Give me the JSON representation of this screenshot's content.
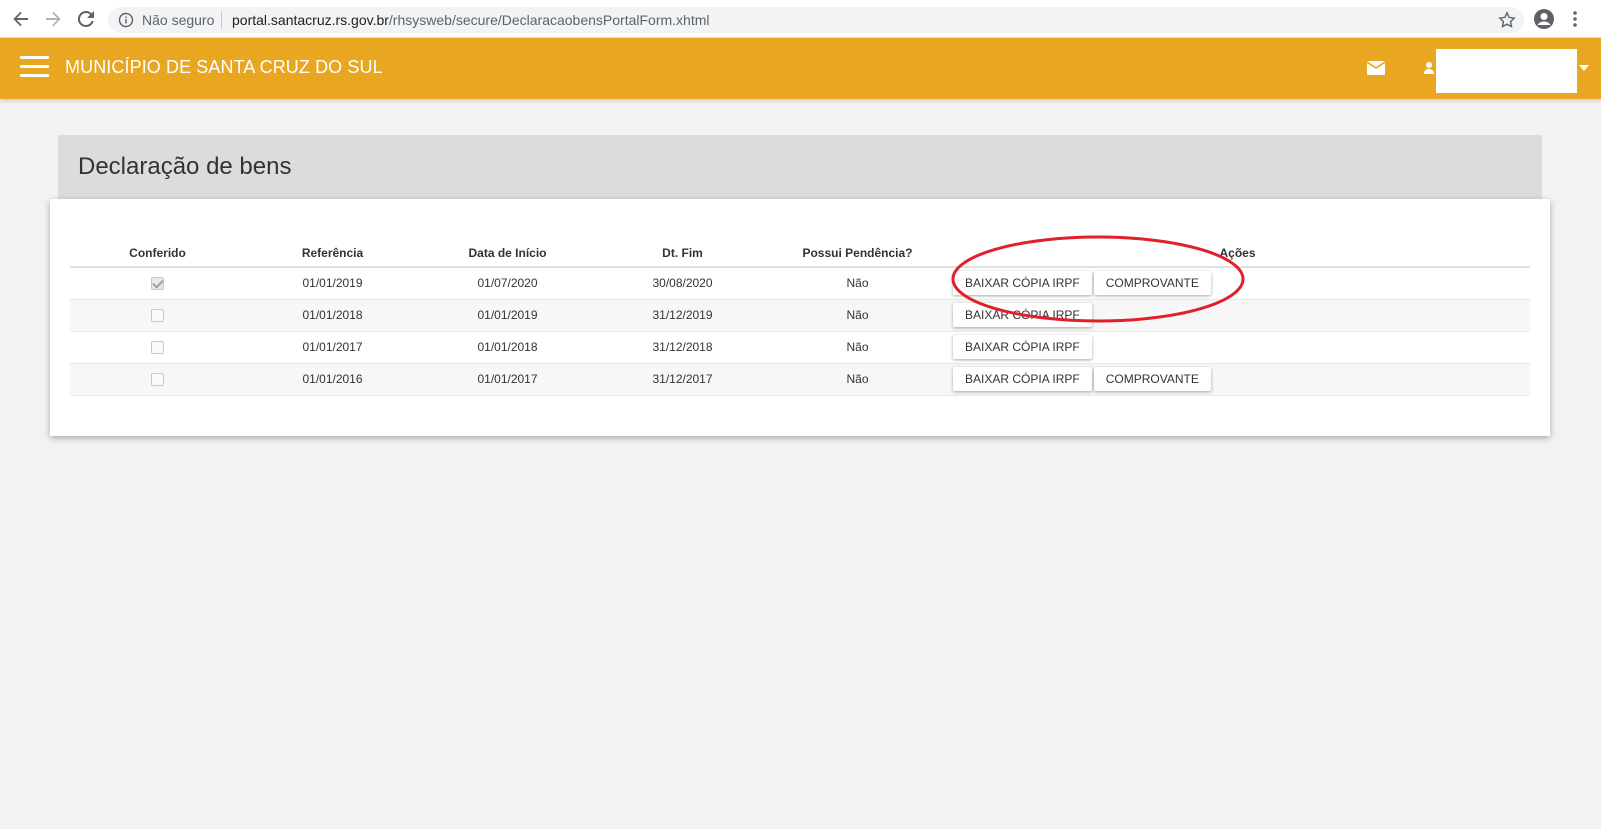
{
  "browser": {
    "not_secure": "Não seguro",
    "url_domain": "portal.santacruz.rs.gov.br",
    "url_path": "/rhsysweb/secure/DeclaracaobensPortalForm.xhtml"
  },
  "header": {
    "title": "MUNICÍPIO DE SANTA CRUZ DO SUL",
    "color": "#e9a620"
  },
  "panel": {
    "title": "Declaração de bens"
  },
  "table": {
    "columns": {
      "conferido": "Conferido",
      "referencia": "Referência",
      "data_inicio": "Data de Início",
      "dt_fim": "Dt. Fim",
      "pendencia": "Possui Pendência?",
      "acoes": "Ações"
    },
    "rows": [
      {
        "conferido": true,
        "referencia": "01/01/2019",
        "data_inicio": "01/07/2020",
        "dt_fim": "30/08/2020",
        "pendencia": "Não",
        "btn_irpf": "BAIXAR CÓPIA IRPF",
        "btn_comprovante": "COMPROVANTE"
      },
      {
        "conferido": false,
        "referencia": "01/01/2018",
        "data_inicio": "01/01/2019",
        "dt_fim": "31/12/2019",
        "pendencia": "Não",
        "btn_irpf": "BAIXAR CÓPIA IRPF"
      },
      {
        "conferido": false,
        "referencia": "01/01/2017",
        "data_inicio": "01/01/2018",
        "dt_fim": "31/12/2018",
        "pendencia": "Não",
        "btn_irpf": "BAIXAR CÓPIA IRPF"
      },
      {
        "conferido": false,
        "referencia": "01/01/2016",
        "data_inicio": "01/01/2017",
        "dt_fim": "31/12/2017",
        "pendencia": "Não",
        "btn_irpf": "BAIXAR CÓPIA IRPF",
        "btn_comprovante": "COMPROVANTE"
      }
    ]
  },
  "annotation": {
    "color": "#e0202a"
  }
}
